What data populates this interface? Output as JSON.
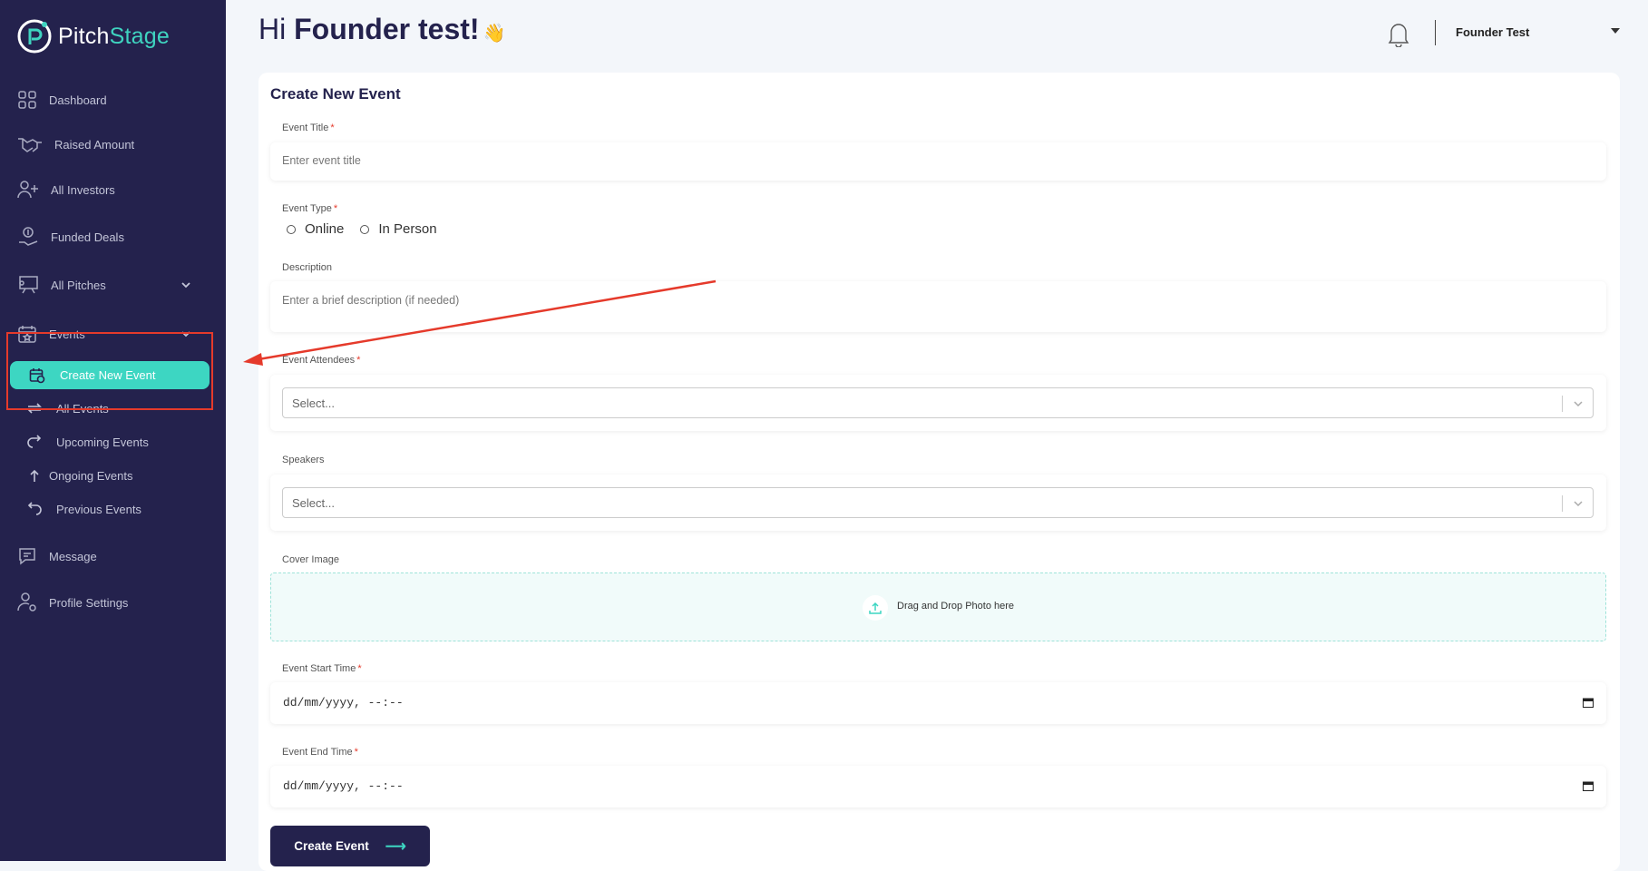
{
  "brand": {
    "name_part1": "Pitch",
    "name_part2": "Stage"
  },
  "sidebar": {
    "items": [
      {
        "label": "Dashboard",
        "icon": "grid-icon"
      },
      {
        "label": "Raised Amount",
        "icon": "handshake-icon"
      },
      {
        "label": "All Investors",
        "icon": "investors-icon"
      },
      {
        "label": "Funded Deals",
        "icon": "money-hand-icon"
      },
      {
        "label": "All Pitches",
        "icon": "presentation-icon"
      },
      {
        "label": "Events",
        "icon": "calendar-star-icon"
      },
      {
        "label": "Message",
        "icon": "message-icon"
      },
      {
        "label": "Profile Settings",
        "icon": "user-gear-icon"
      }
    ],
    "events_sub": {
      "active": "Create New Event",
      "items": [
        "All Events",
        "Upcoming Events",
        "Ongoing Events",
        "Previous Events"
      ]
    }
  },
  "header": {
    "greeting_prefix": "Hi",
    "greeting_name": "Founder test!",
    "wave": "👋",
    "user_name": "Founder Test"
  },
  "form": {
    "title": "Create New Event",
    "event_title_label": "Event Title",
    "event_title_placeholder": "Enter event title",
    "event_type_label": "Event Type",
    "event_type_options": [
      "Online",
      "In Person"
    ],
    "description_label": "Description",
    "description_placeholder": "Enter a brief description (if needed)",
    "attendees_label": "Event Attendees",
    "attendees_placeholder": "Select...",
    "speakers_label": "Speakers",
    "speakers_placeholder": "Select...",
    "cover_label": "Cover Image",
    "cover_drop_text": "Drag and Drop Photo here",
    "start_label": "Event Start Time",
    "start_value": "dd/mm/yyyy, --:--",
    "end_label": "Event End Time",
    "end_value": "dd/mm/yyyy, --:--",
    "submit_label": "Create Event",
    "required_mark": "*"
  },
  "colors": {
    "sidebar_bg": "#24224d",
    "accent": "#3dd6c2",
    "annotation": "#e53a2b"
  }
}
